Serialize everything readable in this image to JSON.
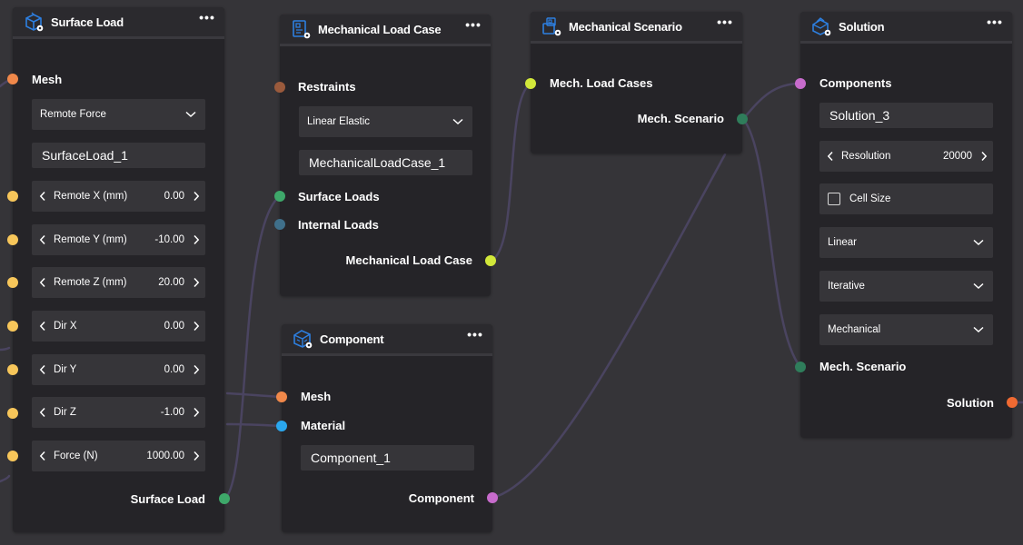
{
  "colors": {
    "canvas": "#353438",
    "node_body": "#252428",
    "node_header": "#2b2a2e",
    "field": "#363539",
    "wire": "#4a4460",
    "port_orange": "#f0884a",
    "port_yellow": "#f7c65a",
    "port_brown": "#9a5a3c",
    "port_green": "#3ea86a",
    "port_slate": "#3f6f8a",
    "port_lime": "#d2e83a",
    "port_teal": "#2f7d5b",
    "port_blue": "#2aa7ee",
    "port_pink": "#c76bcc",
    "port_red_orange": "#f06a32",
    "icon_blue": "#2d7fe0"
  },
  "surface_load": {
    "title": "Surface Load",
    "icon": "box-gear-icon",
    "menu": "•••",
    "mesh_label": "Mesh",
    "load_type": "Remote Force",
    "name_value": "SurfaceLoad_1",
    "params": [
      {
        "label": "Remote X (mm)",
        "value": "0.00"
      },
      {
        "label": "Remote Y (mm)",
        "value": "-10.00"
      },
      {
        "label": "Remote Z (mm)",
        "value": "20.00"
      },
      {
        "label": "Dir X",
        "value": "0.00"
      },
      {
        "label": "Dir Y",
        "value": "0.00"
      },
      {
        "label": "Dir Z",
        "value": "-1.00"
      },
      {
        "label": "Force (N)",
        "value": "1000.00"
      }
    ],
    "output_label": "Surface Load"
  },
  "load_case": {
    "title": "Mechanical Load Case",
    "icon": "load-case-gear-icon",
    "menu": "•••",
    "restraints_label": "Restraints",
    "analysis_type": "Linear Elastic",
    "name_value": "MechanicalLoadCase_1",
    "surface_loads_label": "Surface Loads",
    "internal_loads_label": "Internal Loads",
    "output_label": "Mechanical Load Case"
  },
  "scenario": {
    "title": "Mechanical Scenario",
    "icon": "scenario-gear-icon",
    "menu": "•••",
    "input_label": "Mech. Load Cases",
    "output_label": "Mech. Scenario"
  },
  "component": {
    "title": "Component",
    "icon": "cube-gear-icon",
    "menu": "•••",
    "mesh_label": "Mesh",
    "material_label": "Material",
    "name_value": "Component_1",
    "output_label": "Component"
  },
  "solution": {
    "title": "Solution",
    "icon": "solution-gear-icon",
    "menu": "•••",
    "components_label": "Components",
    "name_value": "Solution_3",
    "resolution_label": "Resolution",
    "resolution_value": "20000",
    "cell_size_label": "Cell Size",
    "cell_size_checked": false,
    "option_1": "Linear",
    "option_2": "Iterative",
    "option_3": "Mechanical",
    "scenario_label": "Mech. Scenario",
    "output_label": "Solution"
  }
}
